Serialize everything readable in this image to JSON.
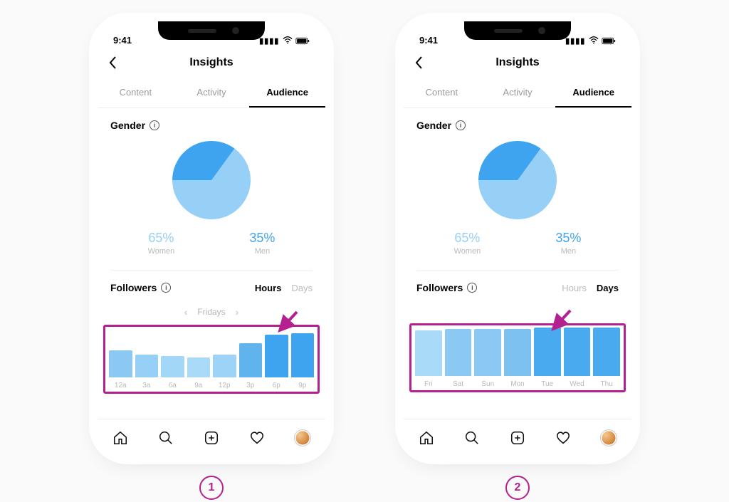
{
  "status": {
    "time": "9:41",
    "icons": "••ıll ⬚ ▮"
  },
  "header": {
    "title": "Insights"
  },
  "tabs": {
    "content": "Content",
    "activity": "Activity",
    "audience": "Audience"
  },
  "gender": {
    "title": "Gender",
    "women_pct": "65%",
    "women_label": "Women",
    "men_pct": "35%",
    "men_label": "Men"
  },
  "followers": {
    "title": "Followers",
    "toggle_hours": "Hours",
    "toggle_days": "Days",
    "day_selected": "Fridays"
  },
  "badge1": "1",
  "badge2": "2",
  "chart_data": [
    {
      "type": "bar",
      "title": "Followers active by hour (Fridays)",
      "categories": [
        "12a",
        "3a",
        "6a",
        "9a",
        "12p",
        "3p",
        "6p",
        "9p"
      ],
      "values": [
        38,
        32,
        30,
        28,
        32,
        48,
        60,
        62
      ],
      "ylim": [
        0,
        70
      ],
      "colors": [
        "#8cc9f2",
        "#97d0f6",
        "#a3d7f7",
        "#a9dbf8",
        "#9dd3f6",
        "#5fb4ee",
        "#3ea4f0",
        "#3ea4f0"
      ]
    },
    {
      "type": "bar",
      "title": "Followers active by day",
      "categories": [
        "Fri",
        "Sat",
        "Sun",
        "Mon",
        "Tue",
        "Wed",
        "Thu"
      ],
      "values": [
        64,
        66,
        66,
        66,
        68,
        68,
        68
      ],
      "ylim": [
        0,
        70
      ],
      "colors": [
        "#a9dbf8",
        "#8cc9f2",
        "#8cc9f2",
        "#7dc1f1",
        "#4aaaef",
        "#4aaaef",
        "#4aaaef"
      ]
    }
  ]
}
